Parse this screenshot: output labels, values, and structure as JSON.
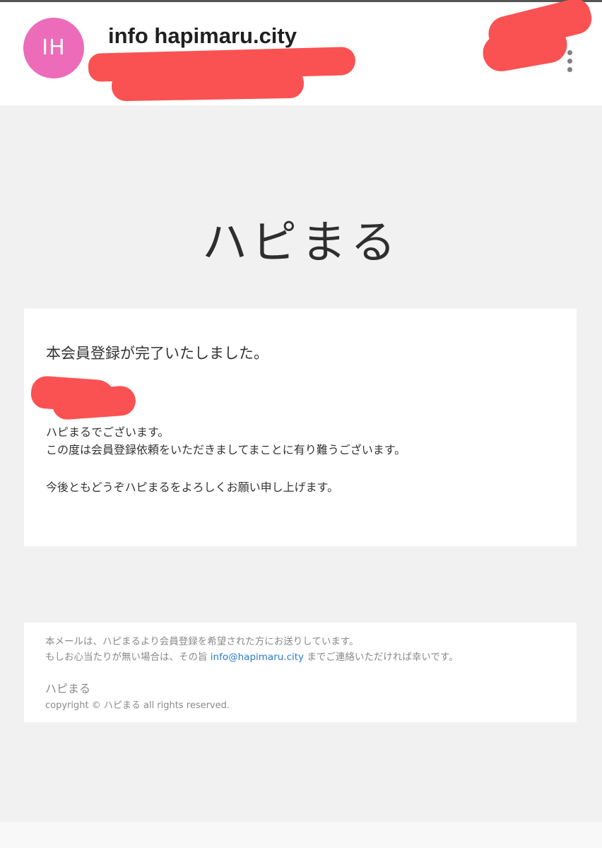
{
  "header": {
    "avatar_initials": "IH",
    "avatar_color": "#ec6cb9",
    "sender_name": "info hapimaru.city",
    "more_icon": "more-vert-icon"
  },
  "brand": {
    "title": "ハピまる"
  },
  "message": {
    "title": "本会員登録が完了いたしました。",
    "greeting": "ハピまるでございます。",
    "thanks": "この度は会員登録依頼をいただきましてまことに有り難うございます。",
    "closing": "今後ともどうぞハピまるをよろしくお願い申し上げます。"
  },
  "footer": {
    "notice_line1": "本メールは、ハピまるより会員登録を希望された方にお送りしています。",
    "notice_line2_prefix": "もしお心当たりが無い場合は、その旨 ",
    "contact_email": "info@hapimaru.city",
    "notice_line2_suffix": " までご連絡いただければ幸いです。",
    "brand": "ハピまる",
    "copyright": "copyright © ハピまる all rights reserved.",
    "link_color": "#2a7bd0"
  }
}
